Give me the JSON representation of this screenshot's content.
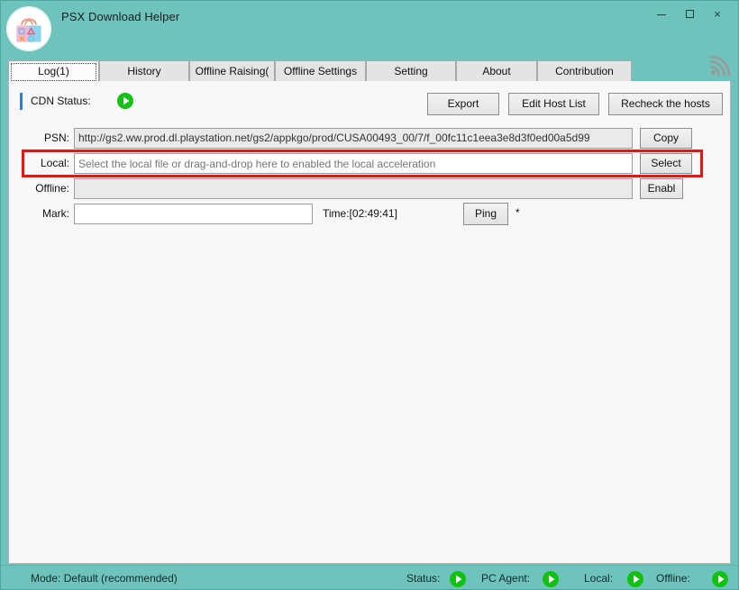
{
  "window": {
    "title": "PSX Download Helper",
    "app_icon": "playstation-store-icon",
    "controls": {
      "minimize": "minimize-icon",
      "maximize": "maximize-icon",
      "close": "×"
    },
    "theme": {
      "titlebar_bg": "#6ec3bd",
      "content_bg": "#f8f8f8",
      "accent_blue": "#2f7fd0",
      "led_green": "#12c212",
      "highlight_red": "#ee1111"
    }
  },
  "tabs": {
    "items": [
      {
        "label": "Log(1)",
        "active": true
      },
      {
        "label": "History",
        "active": false
      },
      {
        "label": "Offline Raising(",
        "active": false
      },
      {
        "label": "Offline Settings",
        "active": false
      },
      {
        "label": "Setting",
        "active": false
      },
      {
        "label": "About",
        "active": false
      },
      {
        "label": "Contribution",
        "active": false
      }
    ],
    "rss_icon": "rss-feed-icon"
  },
  "toolbar": {
    "cdn_status_label": "CDN Status:",
    "cdn_status_led": "green-play-led",
    "export_label": "Export",
    "edit_host_list_label": "Edit Host List",
    "recheck_hosts_label": "Recheck the hosts"
  },
  "form": {
    "psn": {
      "label": "PSN:",
      "value": "http://gs2.ww.prod.dl.playstation.net/gs2/appkgo/prod/CUSA00493_00/7/f_00fc11c1eea3e8d3f0ed00a5d99",
      "button": "Copy"
    },
    "local": {
      "label": "Local:",
      "placeholder": "Select the local file or drag-and-drop here to enabled the local acceleration",
      "value": "",
      "button": "Select",
      "highlighted": true
    },
    "offline": {
      "label": "Offline:",
      "value": "",
      "button": "Enabl"
    },
    "mark": {
      "label": "Mark:",
      "value": "",
      "time_text": "Time:[02:49:41]",
      "ping_button": "Ping",
      "asterisk": "*"
    }
  },
  "statusbar": {
    "mode_label": "Mode:",
    "mode_value": "Default (recommended)",
    "status_label": "Status:",
    "pc_agent_label": "PC Agent:",
    "local_label": "Local:",
    "offline_label": "Offline:",
    "led": "green-play-led"
  }
}
